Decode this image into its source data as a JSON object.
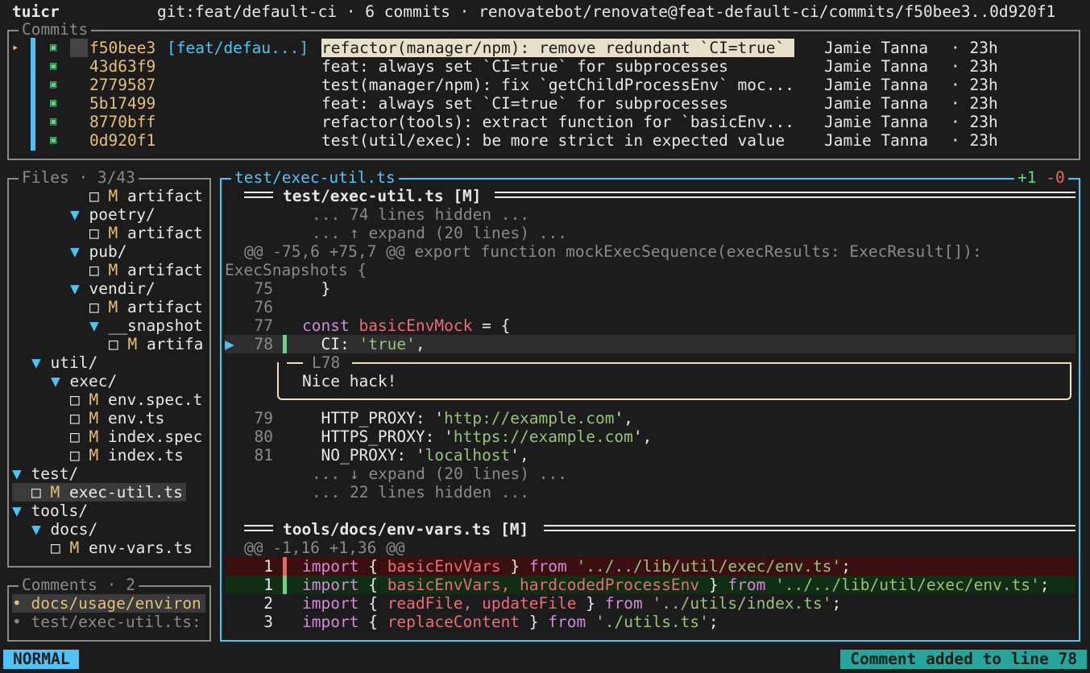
{
  "app_name": "tuicr",
  "header_info": "git:feat/default-ci · 6 commits · renovatebot/renovate@feat-default-ci/commits/f50bee3..0d920f1",
  "commits": {
    "title": "Commits",
    "rows": [
      {
        "hash": "f50bee3",
        "branch": "[feat/defau...]",
        "message": "refactor(manager/npm): remove redundant `CI=true`",
        "author": "Jamie Tanna",
        "age": "· 23h"
      },
      {
        "hash": "43d63f9",
        "branch": "",
        "message": "feat: always set `CI=true` for subprocesses",
        "author": "Jamie Tanna",
        "age": "· 23h"
      },
      {
        "hash": "2779587",
        "branch": "",
        "message": "test(manager/npm): fix `getChildProcessEnv` moc...",
        "author": "Jamie Tanna",
        "age": "· 23h"
      },
      {
        "hash": "5b17499",
        "branch": "",
        "message": "feat: always set `CI=true` for subprocesses",
        "author": "Jamie Tanna",
        "age": "· 23h"
      },
      {
        "hash": "8770bff",
        "branch": "",
        "message": "refactor(tools): extract function for `basicEnv...",
        "author": "Jamie Tanna",
        "age": "· 23h"
      },
      {
        "hash": "0d920f1",
        "branch": "",
        "message": "test(util/exec): be more strict in expected value",
        "author": "Jamie Tanna",
        "age": "· 23h"
      }
    ],
    "cursor_glyph": "▸",
    "check_glyph": "▣"
  },
  "files": {
    "title": "Files · 3/43",
    "items": [
      {
        "text": "□ M artifact",
        "type": "file"
      },
      {
        "text": "▼ poetry/",
        "type": "dir"
      },
      {
        "text": "□ M artifact",
        "type": "file"
      },
      {
        "text": "▼ pub/",
        "type": "dir"
      },
      {
        "text": "□ M artifact",
        "type": "file"
      },
      {
        "text": "▼ vendir/",
        "type": "dir"
      },
      {
        "text": "□ M artifact",
        "type": "file"
      },
      {
        "text": "▼ __snapshot",
        "type": "dir"
      },
      {
        "text": "□ M artifa",
        "type": "file"
      },
      {
        "text": "▼ util/",
        "type": "dir"
      },
      {
        "text": "▼ exec/",
        "type": "dir"
      },
      {
        "text": "□ M env.spec.t",
        "type": "file"
      },
      {
        "text": "□ M env.ts",
        "type": "file"
      },
      {
        "text": "□ M index.spec",
        "type": "file"
      },
      {
        "text": "□ M index.ts",
        "type": "file"
      },
      {
        "text": "▼ test/",
        "type": "dir"
      },
      {
        "text": "□ M exec-util.ts",
        "type": "file"
      },
      {
        "text": "▼ tools/",
        "type": "dir"
      },
      {
        "text": "▼ docs/",
        "type": "dir"
      },
      {
        "text": "□ M env-vars.ts",
        "type": "file"
      }
    ]
  },
  "comments": {
    "title": "Comments · 2",
    "items": [
      "• docs/usage/environ",
      "• test/exec-util.ts:"
    ]
  },
  "diff": {
    "title": "test/exec-util.ts",
    "added": "+1",
    "removed": "-0",
    "file1_header": "test/exec-util.ts [M]",
    "hidden_top": "... 74 lines hidden ...",
    "expand_up": "... ↑ expand (20 lines) ...",
    "hunk1": "@@ -75,6 +75,7 @@ export function mockExecSequence(execResults: ExecResult[]):",
    "hunk1_cont": "ExecSnapshots {",
    "lines1": [
      {
        "num": "75",
        "code": "  }"
      },
      {
        "num": "76",
        "code": ""
      },
      {
        "num": "77",
        "kw": "const ",
        "id": "basicEnvMock",
        "rest": " = {"
      },
      {
        "num": "78",
        "pre": "  CI: ",
        "str": "'true'",
        "post": ","
      }
    ],
    "cursor_arrow": "▶",
    "comment": {
      "label": "L78",
      "text": "Nice hack!"
    },
    "lines2": [
      {
        "num": "79",
        "pre": "  HTTP_PROXY: '",
        "str": "http://example.com",
        "post": "',"
      },
      {
        "num": "80",
        "pre": "  HTTPS_PROXY: '",
        "str": "https://example.com",
        "post": "',"
      },
      {
        "num": "81",
        "pre": "  NO_PROXY: '",
        "str": "localhost",
        "post": "',"
      }
    ],
    "expand_down": "... ↓ expand (20 lines) ...",
    "hidden_bottom": "... 22 lines hidden ...",
    "file2_header": "tools/docs/env-vars.ts [M]",
    "hunk2": "@@ -1,16 +1,36 @@",
    "import_lines": [
      {
        "num": "1",
        "kind": "del",
        "a": "import { ",
        "ids": "basicEnvVars",
        "b": " } from ",
        "s": "'../../lib/util/exec/env.ts'",
        "c": ";"
      },
      {
        "num": "1",
        "kind": "add",
        "a": "import { ",
        "ids": "basicEnvVars, hardcodedProcessEnv",
        "b": " } from ",
        "s": "'../../lib/util/exec/env.ts'",
        "c": ";"
      },
      {
        "num": "2",
        "kind": "ctx",
        "a": "import { ",
        "ids": "readFile, updateFile",
        "b": " } from ",
        "s": "'../utils/index.ts'",
        "c": ";"
      },
      {
        "num": "3",
        "kind": "ctx",
        "a": "import { ",
        "ids": "replaceContent",
        "b": " } from ",
        "s": "'./utils.ts'",
        "c": ";"
      }
    ]
  },
  "status": {
    "mode": "NORMAL",
    "message": "Comment added to line 78"
  },
  "colors": {
    "accent_cyan": "#4fc3f7",
    "hash_yellow": "#e5c07b",
    "added_green": "#5fd787",
    "removed_red": "#ef6461",
    "del_bg": "#3a0f0f",
    "add_bg": "#0f2e14"
  }
}
